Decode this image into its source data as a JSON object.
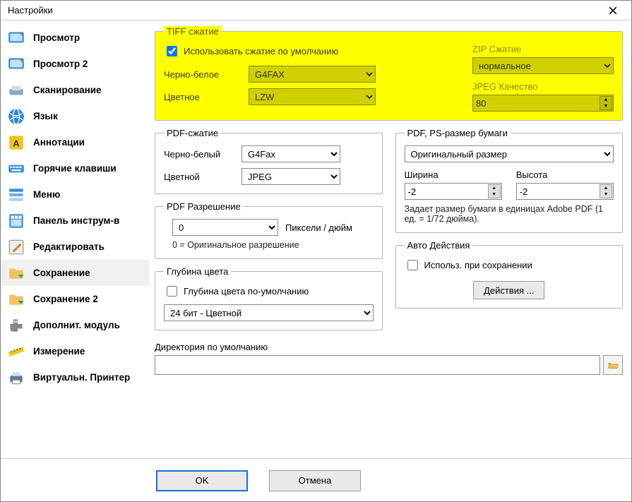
{
  "window": {
    "title": "Настройки"
  },
  "sidebar": {
    "items": [
      {
        "label": "Просмотр"
      },
      {
        "label": "Просмотр 2"
      },
      {
        "label": "Сканирование"
      },
      {
        "label": "Язык"
      },
      {
        "label": "Аннотации"
      },
      {
        "label": "Горячие клавиши"
      },
      {
        "label": "Меню"
      },
      {
        "label": "Панель инструм-в"
      },
      {
        "label": "Редактировать"
      },
      {
        "label": "Сохранение"
      },
      {
        "label": "Сохранение 2"
      },
      {
        "label": "Дополнит. модуль"
      },
      {
        "label": "Измерение"
      },
      {
        "label": "Виртуальн. Принтер"
      }
    ]
  },
  "tiff": {
    "legend": "TIFF сжатие",
    "use_default": "Использовать сжатие по умолчанию",
    "bw_label": "Черно-белое",
    "bw_value": "G4FAX",
    "color_label": "Цветное",
    "color_value": "LZW",
    "zip_label": "ZIP Сжатие",
    "zip_value": "нормальное",
    "jpeg_label": "JPEG Качество",
    "jpeg_value": "80"
  },
  "pdf": {
    "legend": "PDF-сжатие",
    "bw_label": "Черно-белый",
    "bw_value": "G4Fax",
    "color_label": "Цветной",
    "color_value": "JPEG"
  },
  "pdfres": {
    "legend": "PDF Разрешение",
    "value": "0",
    "unit": "Пиксели / дюйм",
    "note": "0 = Оригинальное разрешение"
  },
  "paper": {
    "legend": "PDF, PS-размер бумаги",
    "size_value": "Оригинальный размер",
    "width_label": "Ширина",
    "width_value": "-2",
    "height_label": "Высота",
    "height_value": "-2",
    "note": "Задает размер бумаги в единицах Adobe PDF (1 ед. = 1/72 дюйма)."
  },
  "depth": {
    "legend": "Глубина цвета",
    "default_label": "Глубина цвета по-умолчанию",
    "value": "24 бит - Цветной"
  },
  "auto": {
    "legend": "Авто Действия",
    "use_label": "Использ. при сохранении",
    "actions_btn": "Действия ..."
  },
  "dir": {
    "label": "Директория по умолчанию",
    "value": ""
  },
  "footer": {
    "ok": "OK",
    "cancel": "Отмена"
  }
}
